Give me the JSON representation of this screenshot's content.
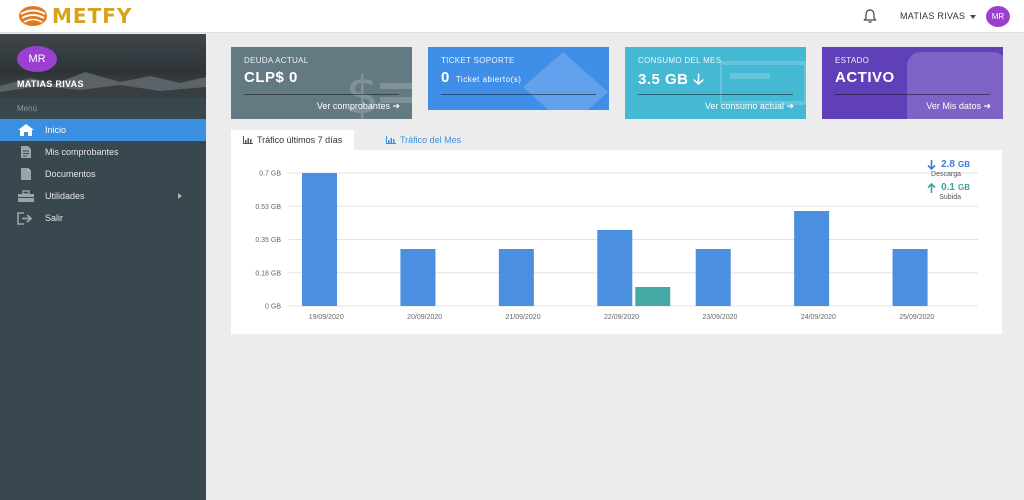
{
  "brand": {
    "name": "METFY"
  },
  "header": {
    "user_name": "MATIAS RIVAS",
    "user_initials": "MR"
  },
  "sidebar": {
    "initials": "MR",
    "name": "MATIAS RIVAS",
    "menu_label": "Menú",
    "items": [
      {
        "label": "Inicio",
        "icon": "home-icon",
        "active": true
      },
      {
        "label": "Mis comprobantes",
        "icon": "receipt-icon"
      },
      {
        "label": "Documentos",
        "icon": "document-icon"
      },
      {
        "label": "Utilidades",
        "icon": "toolbox-icon",
        "has_submenu": true
      },
      {
        "label": "Salir",
        "icon": "logout-icon"
      }
    ]
  },
  "cards": [
    {
      "title": "DEUDA ACTUAL",
      "value": "CLP$ 0",
      "sub": "",
      "link": "Ver comprobantes ➔",
      "color": "#647a83",
      "icon": "money-icon"
    },
    {
      "title": "TICKET SOPORTE",
      "value": "0",
      "sub": "Ticket abierto(s)",
      "link": "",
      "color": "#3f8ee8",
      "icon": "ticket-icon"
    },
    {
      "title": "CONSUMO DEL MES",
      "value": "3.5 GB 🡣",
      "sub": "",
      "link": "Ver consumo actual ➔",
      "color": "#45b8d4",
      "icon": "chart-icon"
    },
    {
      "title": "ESTADO",
      "value": "ACTIVO",
      "sub": "",
      "link": "Ver Mis datos ➔",
      "color": "#6040b8",
      "icon": "status-icon"
    }
  ],
  "tabs": [
    {
      "label": "Tráfico últimos 7 días",
      "active": true
    },
    {
      "label": "Tráfico del Mes",
      "active": false
    }
  ],
  "legend": {
    "download": {
      "value": "2.8",
      "unit": "GB",
      "label": "Descarga",
      "color": "#3b7fd4"
    },
    "upload": {
      "value": "0.1",
      "unit": "GB",
      "label": "Subida",
      "color": "#3aa39c"
    }
  },
  "chart_data": {
    "type": "bar",
    "categories": [
      "19/09/2020",
      "20/09/2020",
      "21/09/2020",
      "22/09/2020",
      "23/09/2020",
      "24/09/2020",
      "25/09/2020"
    ],
    "series": [
      {
        "name": "Descarga",
        "color": "#4a8fe0",
        "values": [
          0.7,
          0.3,
          0.3,
          0.4,
          0.3,
          0.5,
          0.3
        ]
      },
      {
        "name": "Subida",
        "color": "#45a9a5",
        "values": [
          0,
          0,
          0,
          0.1,
          0,
          0,
          0
        ]
      }
    ],
    "y_ticks": [
      {
        "value": 0,
        "label": "0 GB"
      },
      {
        "value": 0.175,
        "label": "0.18 GB"
      },
      {
        "value": 0.35,
        "label": "0.35 GB"
      },
      {
        "value": 0.525,
        "label": "0.53 GB"
      },
      {
        "value": 0.7,
        "label": "0.7 GB"
      }
    ],
    "ylim": [
      0,
      0.7
    ],
    "grid": true
  }
}
